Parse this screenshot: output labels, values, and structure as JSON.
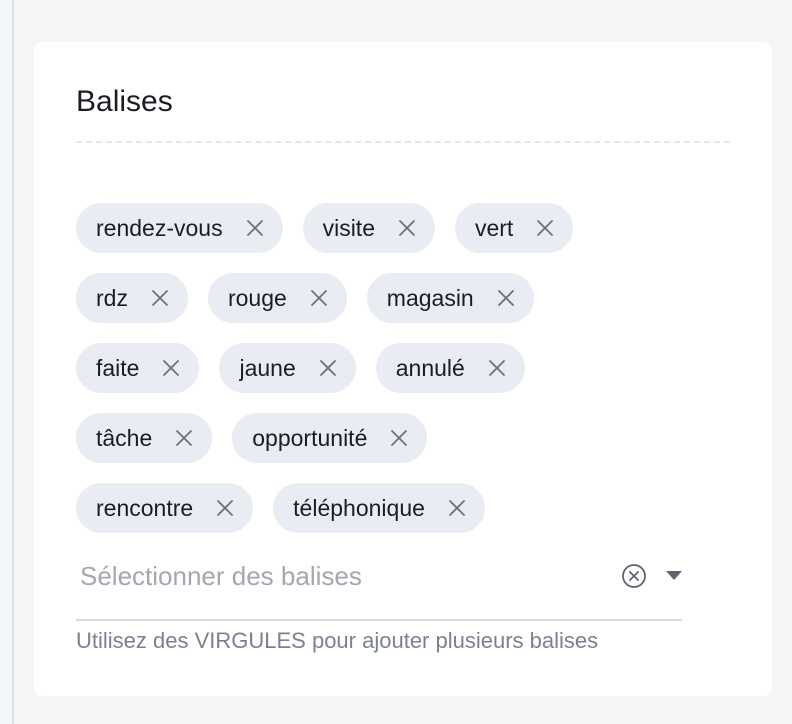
{
  "section": {
    "title": "Balises",
    "tags_rows": [
      [
        "rendez-vous",
        "visite",
        "vert"
      ],
      [
        "rdz",
        "rouge",
        "magasin"
      ],
      [
        "faite",
        "jaune",
        "annulé"
      ],
      [
        "tâche",
        "opportunité"
      ],
      [
        "rencontre",
        "téléphonique"
      ]
    ],
    "select": {
      "placeholder": "Sélectionner des balises",
      "value": ""
    },
    "helper": "Utilisez des VIRGULES pour ajouter plusieurs balises"
  },
  "icons": {
    "tag_remove": "close-icon",
    "clear": "clear-circle-icon",
    "dropdown": "caret-down-icon"
  },
  "colors": {
    "page_background": "#f4f5f7",
    "card_background": "#ffffff",
    "tag_background": "#e9ecf2",
    "text": "#1b1d22",
    "muted_text": "#7b8190",
    "placeholder": "#a3a7b0"
  }
}
